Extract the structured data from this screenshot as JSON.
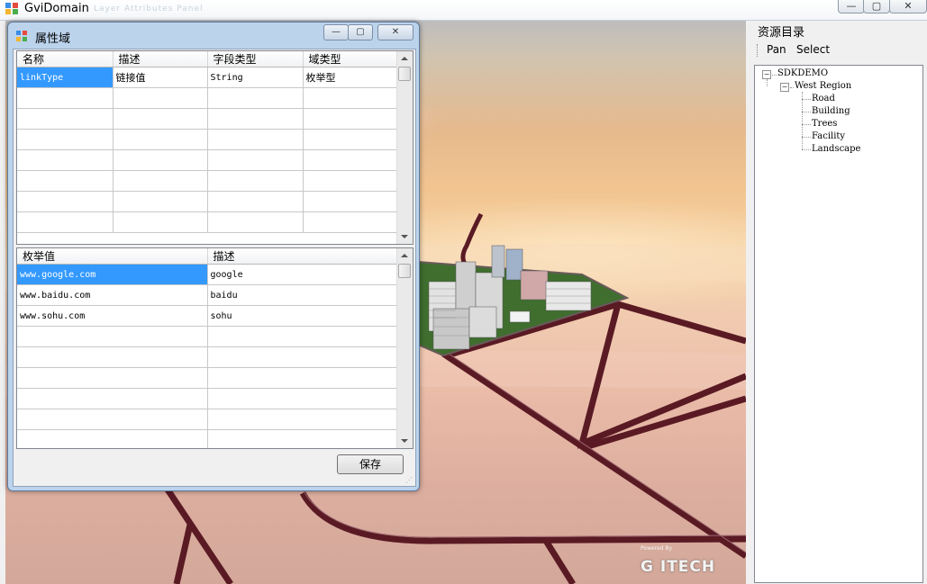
{
  "window": {
    "title": "GviDomain",
    "ghost_title": "Layer Attributes Panel",
    "minimize": "—",
    "maximize": "▢",
    "close": "✕"
  },
  "dialog": {
    "title": "属性域",
    "minimize": "—",
    "maximize": "▢",
    "close": "✕",
    "domains": {
      "columns": [
        "名称",
        "描述",
        "字段类型",
        "域类型"
      ],
      "rows": [
        [
          "linkType",
          "链接值",
          "String",
          "枚举型"
        ]
      ]
    },
    "values": {
      "columns": [
        "枚举值",
        "描述"
      ],
      "rows": [
        [
          "www.google.com",
          "google"
        ],
        [
          "www.baidu.com",
          "baidu"
        ],
        [
          "www.sohu.com",
          "sohu"
        ]
      ]
    },
    "save_label": "保存"
  },
  "right_panel": {
    "title": "资源目录",
    "toolbar": [
      "Pan",
      "Select"
    ],
    "tree": {
      "root": "SDKDEMO",
      "child": "West Region",
      "leaves": [
        "Road",
        "Building",
        "Trees",
        "Facility",
        "Landscape"
      ]
    }
  },
  "viewport": {
    "logo_small": "Powered By",
    "logo": "G  ITECH"
  }
}
